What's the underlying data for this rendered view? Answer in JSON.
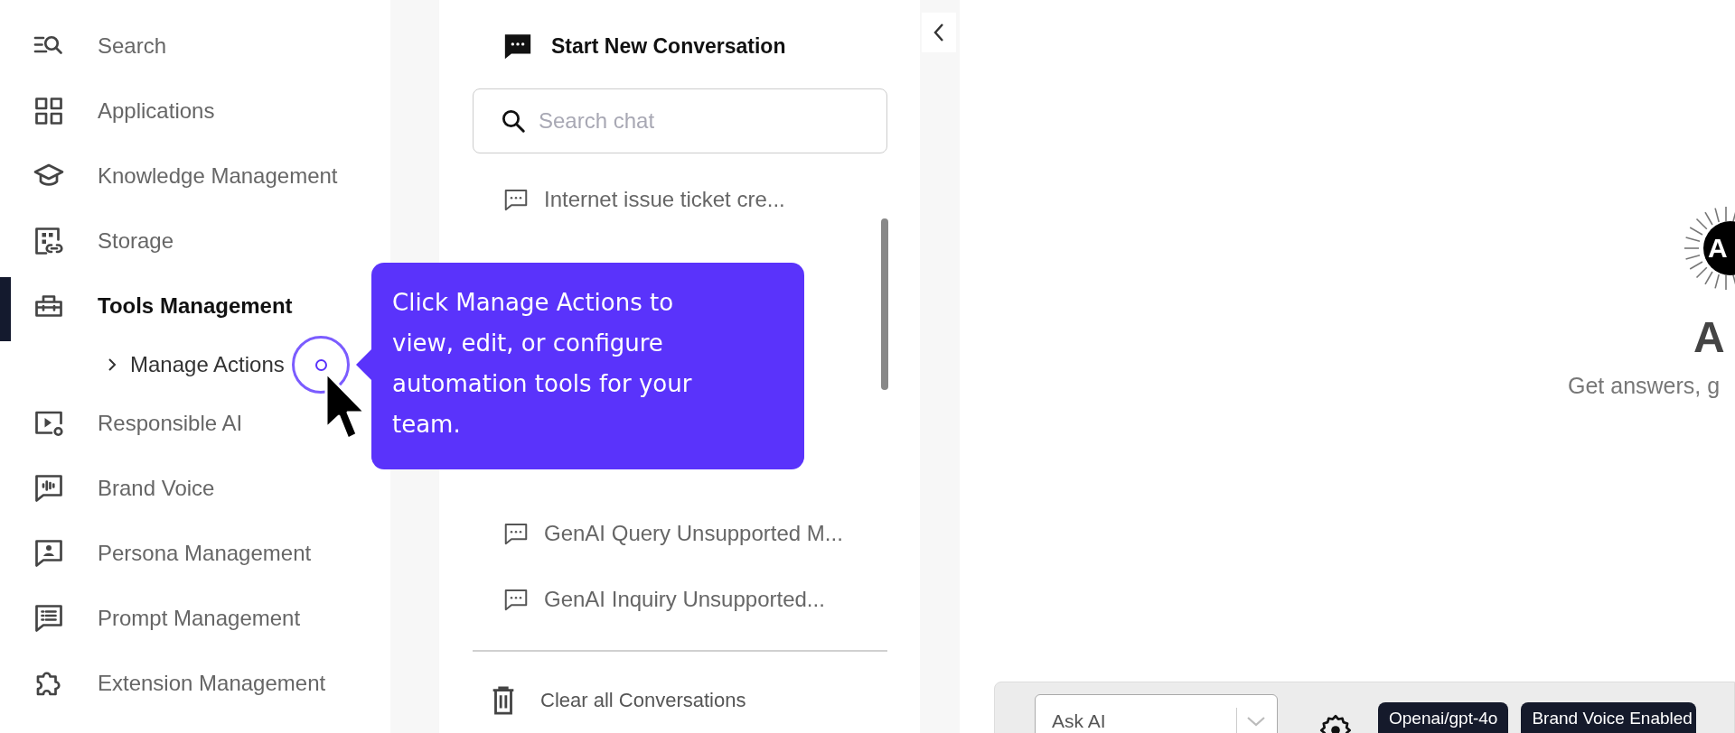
{
  "sidebar": {
    "items": [
      {
        "label": "Search",
        "selected": false
      },
      {
        "label": "Applications",
        "selected": false
      },
      {
        "label": "Knowledge Management",
        "selected": false
      },
      {
        "label": "Storage",
        "selected": false
      },
      {
        "label": "Tools Management",
        "selected": true,
        "children": [
          {
            "label": "Manage Actions",
            "selected": false
          }
        ]
      },
      {
        "label": "Responsible AI",
        "selected": false
      },
      {
        "label": "Brand Voice",
        "selected": false
      },
      {
        "label": "Persona Management",
        "selected": false
      },
      {
        "label": "Prompt Management",
        "selected": false
      },
      {
        "label": "Extension Management",
        "selected": false
      }
    ]
  },
  "chat_panel": {
    "title": "Start New Conversation",
    "search": {
      "placeholder": "Search chat"
    },
    "conversations": [
      {
        "title": "Internet issue ticket cre..."
      },
      {
        "title": "GenAI Query Unsupported M..."
      },
      {
        "title": "GenAI Inquiry Unsupported..."
      }
    ],
    "clear_label": "Clear all Conversations"
  },
  "tooltip": {
    "text": "Click Manage Actions to view, edit, or configure automation tools for your team."
  },
  "main": {
    "logo_letter": "A",
    "title": "A",
    "subtitle": "Get answers, g"
  },
  "composer": {
    "mode_select": {
      "value": "Ask AI"
    },
    "chips": [
      "Openai/gpt-4o",
      "Brand Voice Enabled"
    ]
  }
}
